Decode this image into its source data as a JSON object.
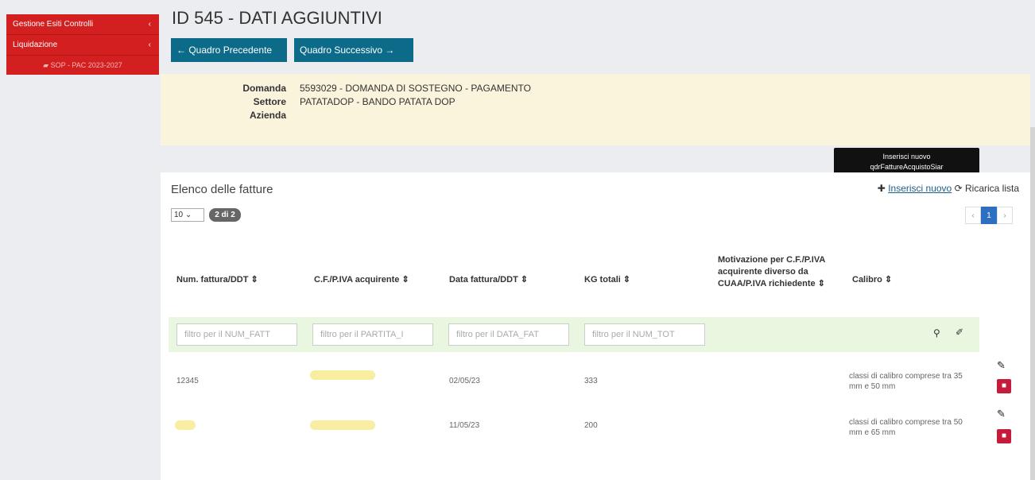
{
  "sidebar": {
    "items": [
      {
        "label": "Gestione Esiti Controlli",
        "chevron": "‹"
      },
      {
        "label": "Liquidazione",
        "chevron": "‹"
      }
    ],
    "sub_item": "SOP - PAC 2023-2027"
  },
  "page": {
    "title": "ID 545 - DATI AGGIUNTIVI",
    "prev_button": "← Quadro Precedente",
    "next_button": "Quadro Successivo →"
  },
  "info": {
    "domanda_label": "Domanda",
    "domanda_value": "5593029 - DOMANDA DI SOSTEGNO - PAGAMENTO",
    "settore_label": "Settore",
    "settore_value": "PATATADOP - BANDO PATATA DOP",
    "azienda_label": "Azienda",
    "azienda_value": ""
  },
  "panel": {
    "title": "Elenco delle fatture",
    "page_size": "10",
    "count_badge": "2 di 2",
    "insert_icon": "plus-icon",
    "insert_label": "Inserisci nuovo",
    "reload_icon": "refresh-icon",
    "reload_label": "Ricarica lista",
    "tooltip_line1": "Inserisci nuovo",
    "tooltip_line2": "qdrFattureAcquistoSiar",
    "pager": {
      "prev": "‹",
      "current": "1",
      "next": "›"
    }
  },
  "table": {
    "columns": [
      "Num. fattura/DDT ⇕",
      "C.F./P.IVA acquirente ⇕",
      "Data fattura/DDT ⇕",
      "KG totali ⇕",
      "Motivazione per C.F./P.IVA acquirente diverso da CUAA/P.IVA richiedente ⇕",
      "Calibro ⇕"
    ],
    "filters": [
      "filtro per il NUM_FATT",
      "filtro per il PARTITA_I",
      "filtro per il DATA_FAT",
      "filtro per il NUM_TOT"
    ],
    "rows": [
      {
        "num": "12345",
        "cf": "",
        "data": "02/05/23",
        "kg": "333",
        "motivazione": "",
        "calibro": "classi di calibro comprese tra 35 mm e 50 mm"
      },
      {
        "num": "",
        "cf": "",
        "data": "11/05/23",
        "kg": "200",
        "motivazione": "",
        "calibro": "classi di calibro comprese tra 50 mm e 65 mm"
      }
    ]
  }
}
